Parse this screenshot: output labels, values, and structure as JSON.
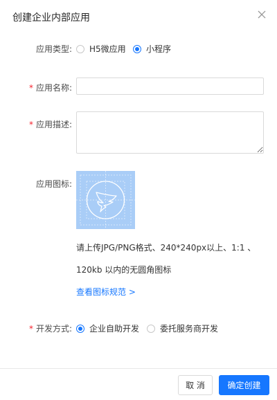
{
  "dialog": {
    "title": "创建企业内部应用"
  },
  "form": {
    "app_type": {
      "label": "应用类型:",
      "options": [
        {
          "label": "H5微应用",
          "selected": false
        },
        {
          "label": "小程序",
          "selected": true
        }
      ]
    },
    "app_name": {
      "label": "应用名称:",
      "required_mark": "*",
      "value": "",
      "placeholder": ""
    },
    "app_desc": {
      "label": "应用描述:",
      "required_mark": "*",
      "value": "",
      "placeholder": ""
    },
    "app_icon": {
      "label": "应用图标:",
      "hint_line1": "请上传JPG/PNG格式、240*240px以上、1:1 、",
      "hint_line2": "120kb 以内的无圆角图标",
      "spec_link": "查看图标规范",
      "spec_link_arrow": ">"
    },
    "dev_mode": {
      "label": "开发方式:",
      "required_mark": "*",
      "options": [
        {
          "label": "企业自助开发",
          "selected": true
        },
        {
          "label": "委托服务商开发",
          "selected": false
        }
      ]
    }
  },
  "footer": {
    "cancel_label": "取 消",
    "confirm_label": "确定创建"
  },
  "colors": {
    "primary": "#1677ff",
    "required": "#f5222d",
    "icon_bg": "#a9cdf7"
  },
  "icons": {
    "close": "close-icon",
    "app_icon_placeholder": "dingtalk-logo-icon"
  }
}
